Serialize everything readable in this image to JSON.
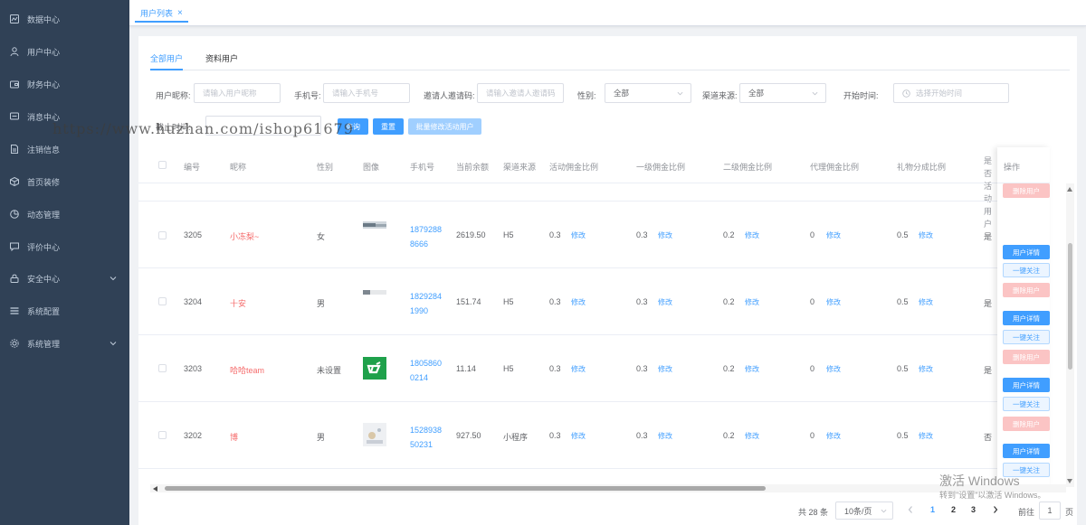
{
  "sidebar": {
    "items": [
      {
        "label": "数据中心",
        "icon": "chart-icon"
      },
      {
        "label": "用户中心",
        "icon": "user-icon"
      },
      {
        "label": "财务中心",
        "icon": "wallet-icon"
      },
      {
        "label": "消息中心",
        "icon": "message-icon"
      },
      {
        "label": "注销信息",
        "icon": "document-icon"
      },
      {
        "label": "首页装修",
        "icon": "cube-icon"
      },
      {
        "label": "动态管理",
        "icon": "pie-icon"
      },
      {
        "label": "评价中心",
        "icon": "comment-icon"
      },
      {
        "label": "安全中心",
        "icon": "lock-icon"
      },
      {
        "label": "系统配置",
        "icon": "list-icon"
      },
      {
        "label": "系统管理",
        "icon": "gear-icon"
      }
    ]
  },
  "watermark": "https://www.huzhan.com/ishop61679",
  "tabs": {
    "active_label": "用户列表",
    "close_symbol": "×"
  },
  "subtabs": [
    {
      "label": "全部用户",
      "active": true
    },
    {
      "label": "资料用户",
      "active": false
    }
  ],
  "filters": {
    "nickname": {
      "label": "用户昵称:",
      "placeholder": "请输入用户昵称"
    },
    "phone": {
      "label": "手机号:",
      "placeholder": "请输入手机号"
    },
    "invite": {
      "label": "邀请人邀请码:",
      "placeholder": "请输入邀请人邀请码"
    },
    "gender": {
      "label": "性别:",
      "value": "全部"
    },
    "channel": {
      "label": "渠道来源:",
      "value": "全部"
    },
    "start_time": {
      "label": "开始时间:",
      "placeholder": "选择开始时间"
    },
    "end_time": {
      "label": "截止时间:"
    }
  },
  "buttons": {
    "query": "查询",
    "reset": "重置",
    "batch_edit": "批量修改活动用户"
  },
  "table": {
    "columns": [
      "编号",
      "昵称",
      "性别",
      "图像",
      "手机号",
      "当前余额",
      "渠道来源",
      "活动佣金比例",
      "一级佣金比例",
      "二级佣金比例",
      "代理佣金比例",
      "礼物分成比例",
      "是否活动用户",
      "操作"
    ],
    "edit_label": "修改",
    "rows": [
      {
        "id": "3205",
        "nickname": "小冻梨~",
        "gender": "女",
        "phone1": "1879288",
        "phone2": "8666",
        "balance": "2619.50",
        "channel": "H5",
        "activity": "0.3",
        "level1": "0.3",
        "level2": "0.2",
        "agent": "0",
        "gift": "0.5",
        "is_active": "是"
      },
      {
        "id": "3204",
        "nickname": "十安",
        "gender": "男",
        "phone1": "1829284",
        "phone2": "1990",
        "balance": "151.74",
        "channel": "H5",
        "activity": "0.3",
        "level1": "0.3",
        "level2": "0.2",
        "agent": "0",
        "gift": "0.5",
        "is_active": "是"
      },
      {
        "id": "3203",
        "nickname": "哈哈team",
        "gender": "未设置",
        "phone1": "1805860",
        "phone2": "0214",
        "balance": "11.14",
        "channel": "H5",
        "activity": "0.3",
        "level1": "0.3",
        "level2": "0.2",
        "agent": "0",
        "gift": "0.5",
        "is_active": "是"
      },
      {
        "id": "3202",
        "nickname": "博",
        "gender": "男",
        "phone1": "1528938",
        "phone2": "50231",
        "balance": "927.50",
        "channel": "小程序",
        "activity": "0.3",
        "level1": "0.3",
        "level2": "0.2",
        "agent": "0",
        "gift": "0.5",
        "is_active": "否"
      }
    ]
  },
  "actions": {
    "detail": "用户详情",
    "follow": "一键关注",
    "delete": "删除用户"
  },
  "pagination": {
    "total": "共 28 条",
    "page_size": "10条/页",
    "pages": [
      "1",
      "2",
      "3"
    ],
    "current": "1",
    "goto_prefix": "前往",
    "goto_value": "1",
    "goto_suffix": "页"
  },
  "windows_overlay": {
    "line1": "激活 Windows",
    "line2": "转到\"设置\"以激活 Windows。"
  },
  "colors": {
    "sidebar_bg": "#304156",
    "primary": "#409eff",
    "danger": "#f56c6c"
  }
}
